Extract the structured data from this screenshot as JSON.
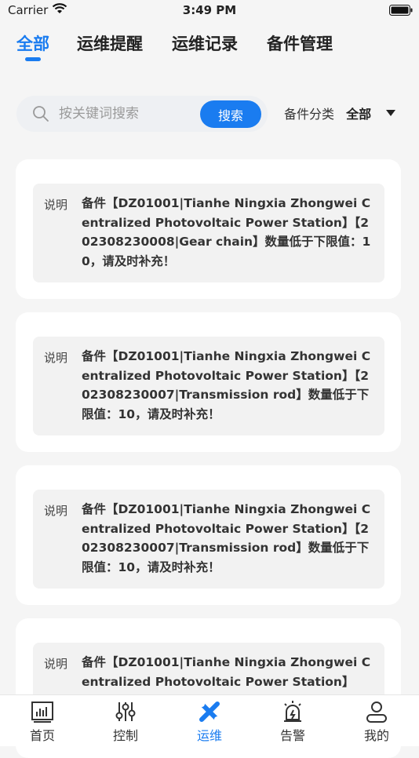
{
  "status": {
    "carrier": "Carrier",
    "time": "3:49 PM"
  },
  "tabs": [
    {
      "label": "全部",
      "active": true
    },
    {
      "label": "运维提醒",
      "active": false
    },
    {
      "label": "运维记录",
      "active": false
    },
    {
      "label": "备件管理",
      "active": false
    }
  ],
  "search": {
    "placeholder": "按关键词搜索",
    "value": "",
    "button_label": "搜索"
  },
  "filter": {
    "label": "备件分类",
    "value": "全部"
  },
  "cards": [
    {
      "label": "说明",
      "text": "备件【DZ01001|Tianhe Ningxia Zhongwei Centralized Photovoltaic Power Station】【202308230008|Gear chain】数量低于下限值：10，请及时补充！"
    },
    {
      "label": "说明",
      "text": "备件【DZ01001|Tianhe Ningxia Zhongwei Centralized Photovoltaic Power Station】【202308230007|Transmission rod】数量低于下限值：10，请及时补充！"
    },
    {
      "label": "说明",
      "text": "备件【DZ01001|Tianhe Ningxia Zhongwei Centralized Photovoltaic Power Station】【202308230007|Transmission rod】数量低于下限值：10，请及时补充！"
    },
    {
      "label": "说明",
      "text": "备件【DZ01001|Tianhe Ningxia Zhongwei Centralized Photovoltaic Power Station】"
    }
  ],
  "nav": [
    {
      "label": "首页",
      "icon": "home-chart-icon",
      "active": false
    },
    {
      "label": "控制",
      "icon": "sliders-icon",
      "active": false
    },
    {
      "label": "运维",
      "icon": "wrench-icon",
      "active": true
    },
    {
      "label": "告警",
      "icon": "alarm-icon",
      "active": false
    },
    {
      "label": "我的",
      "icon": "user-icon",
      "active": false
    }
  ],
  "colors": {
    "accent": "#1a7cf0",
    "card_inner": "#f2f2f2",
    "background": "#f5f5f5"
  }
}
